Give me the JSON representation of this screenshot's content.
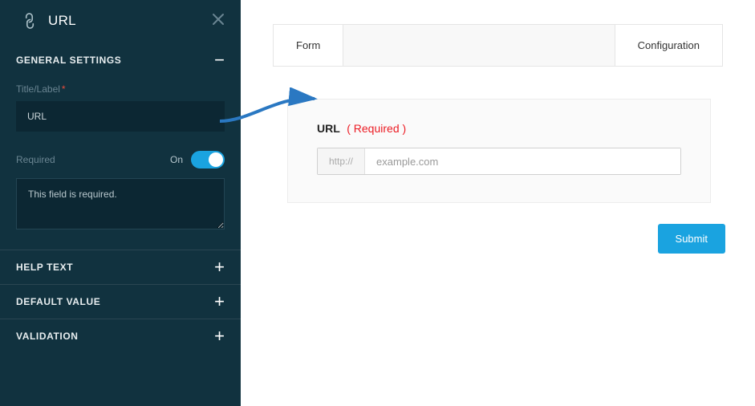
{
  "sidebar": {
    "header_title": "URL",
    "sections": {
      "general": {
        "title": "GENERAL SETTINGS",
        "fields": {
          "title_label": "Title/Label",
          "title_value": "URL",
          "required_label": "Required",
          "required_state": "On",
          "required_message": "This field is required."
        }
      },
      "help_text": {
        "title": "HELP TEXT"
      },
      "default_value": {
        "title": "DEFAULT VALUE"
      },
      "validation": {
        "title": "VALIDATION"
      }
    }
  },
  "main": {
    "tabs": {
      "form": "Form",
      "configuration": "Configuration"
    },
    "form_field": {
      "label": "URL",
      "required_tag": "( Required )",
      "prefix": "http://",
      "placeholder": "example.com"
    },
    "submit_label": "Submit"
  }
}
